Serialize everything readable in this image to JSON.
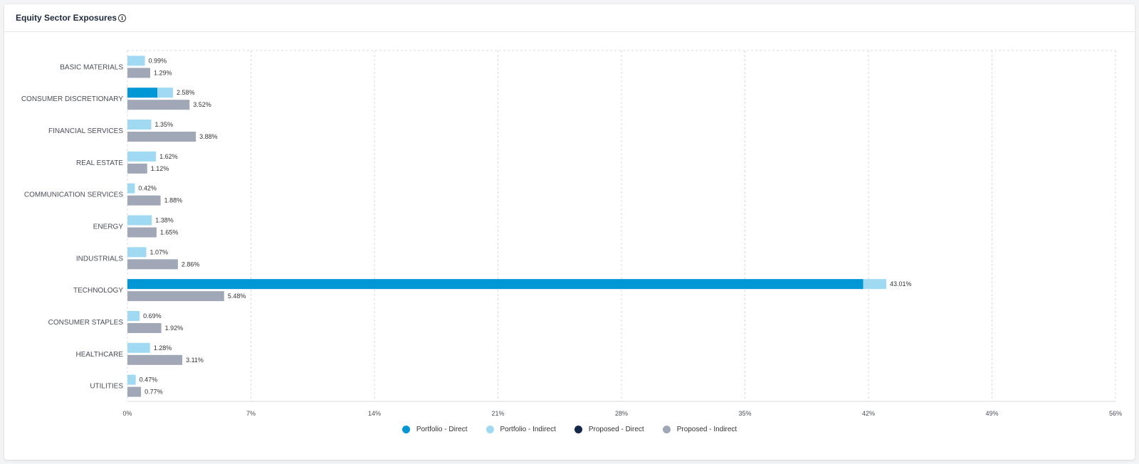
{
  "card": {
    "title": "Equity Sector Exposures",
    "info_icon": "info-icon"
  },
  "colors": {
    "portfolio_direct": "#0097d7",
    "portfolio_indirect": "#9fd9f2",
    "proposed_direct": "#16284a",
    "proposed_indirect": "#a0a7b6",
    "grid": "#d8dbe0",
    "label": "#4a4f57"
  },
  "chart_data": {
    "type": "bar",
    "orientation": "horizontal",
    "stacked": true,
    "categories": [
      "BASIC MATERIALS",
      "CONSUMER DISCRETIONARY",
      "FINANCIAL SERVICES",
      "REAL ESTATE",
      "COMMUNICATION SERVICES",
      "ENERGY",
      "INDUSTRIALS",
      "TECHNOLOGY",
      "CONSUMER STAPLES",
      "HEALTHCARE",
      "UTILITIES"
    ],
    "series": [
      {
        "name": "Portfolio - Direct",
        "values": [
          0,
          1.7,
          0,
          0,
          0,
          0,
          0,
          41.7,
          0,
          0,
          0
        ]
      },
      {
        "name": "Portfolio - Indirect",
        "values": [
          0.99,
          0.88,
          1.35,
          1.62,
          0.42,
          1.38,
          1.07,
          1.31,
          0.69,
          1.28,
          0.47
        ]
      },
      {
        "name": "Proposed - Direct",
        "values": [
          0,
          0,
          0,
          0,
          0,
          0,
          0,
          0,
          0,
          0,
          0
        ]
      },
      {
        "name": "Proposed - Indirect",
        "values": [
          1.29,
          3.52,
          3.88,
          1.12,
          1.88,
          1.65,
          2.86,
          5.48,
          1.92,
          3.11,
          0.77
        ]
      }
    ],
    "data_labels": {
      "portfolio": [
        "0.99%",
        "2.58%",
        "1.35%",
        "1.62%",
        "0.42%",
        "1.38%",
        "1.07%",
        "43.01%",
        "0.69%",
        "1.28%",
        "0.47%"
      ],
      "proposed": [
        "1.29%",
        "3.52%",
        "3.88%",
        "1.12%",
        "1.88%",
        "1.65%",
        "2.86%",
        "5.48%",
        "1.92%",
        "3.11%",
        "0.77%"
      ]
    },
    "x_ticks": [
      0,
      7,
      14,
      21,
      28,
      35,
      42,
      49,
      56
    ],
    "x_tick_labels": [
      "0%",
      "7%",
      "14%",
      "21%",
      "28%",
      "35%",
      "42%",
      "49%",
      "56%"
    ],
    "xlim": [
      0,
      56
    ],
    "grid": true,
    "legend_position": "bottom-center"
  }
}
